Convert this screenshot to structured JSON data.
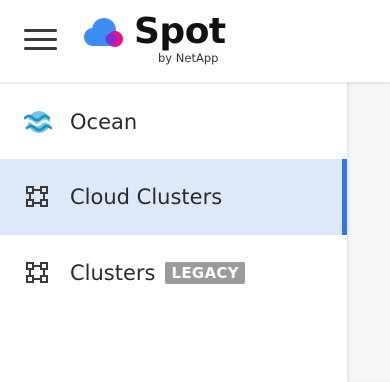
{
  "brand": {
    "name": "Spot",
    "tagline": "by NetApp",
    "colors": {
      "cloud_blue": "#3d8df5",
      "cloud_magenta": "#e5138a",
      "active": "#2f7ae5",
      "active_bg": "#dde9f8"
    }
  },
  "header": {
    "menu_icon": "hamburger-menu-icon"
  },
  "sidebar": {
    "items": [
      {
        "label": "Ocean",
        "icon": "ocean-waves-icon",
        "active": false
      },
      {
        "label": "Cloud Clusters",
        "icon": "cluster-nodes-icon",
        "active": true
      },
      {
        "label": "Clusters",
        "icon": "cluster-nodes-icon",
        "active": false,
        "badge": "LEGACY"
      }
    ]
  }
}
